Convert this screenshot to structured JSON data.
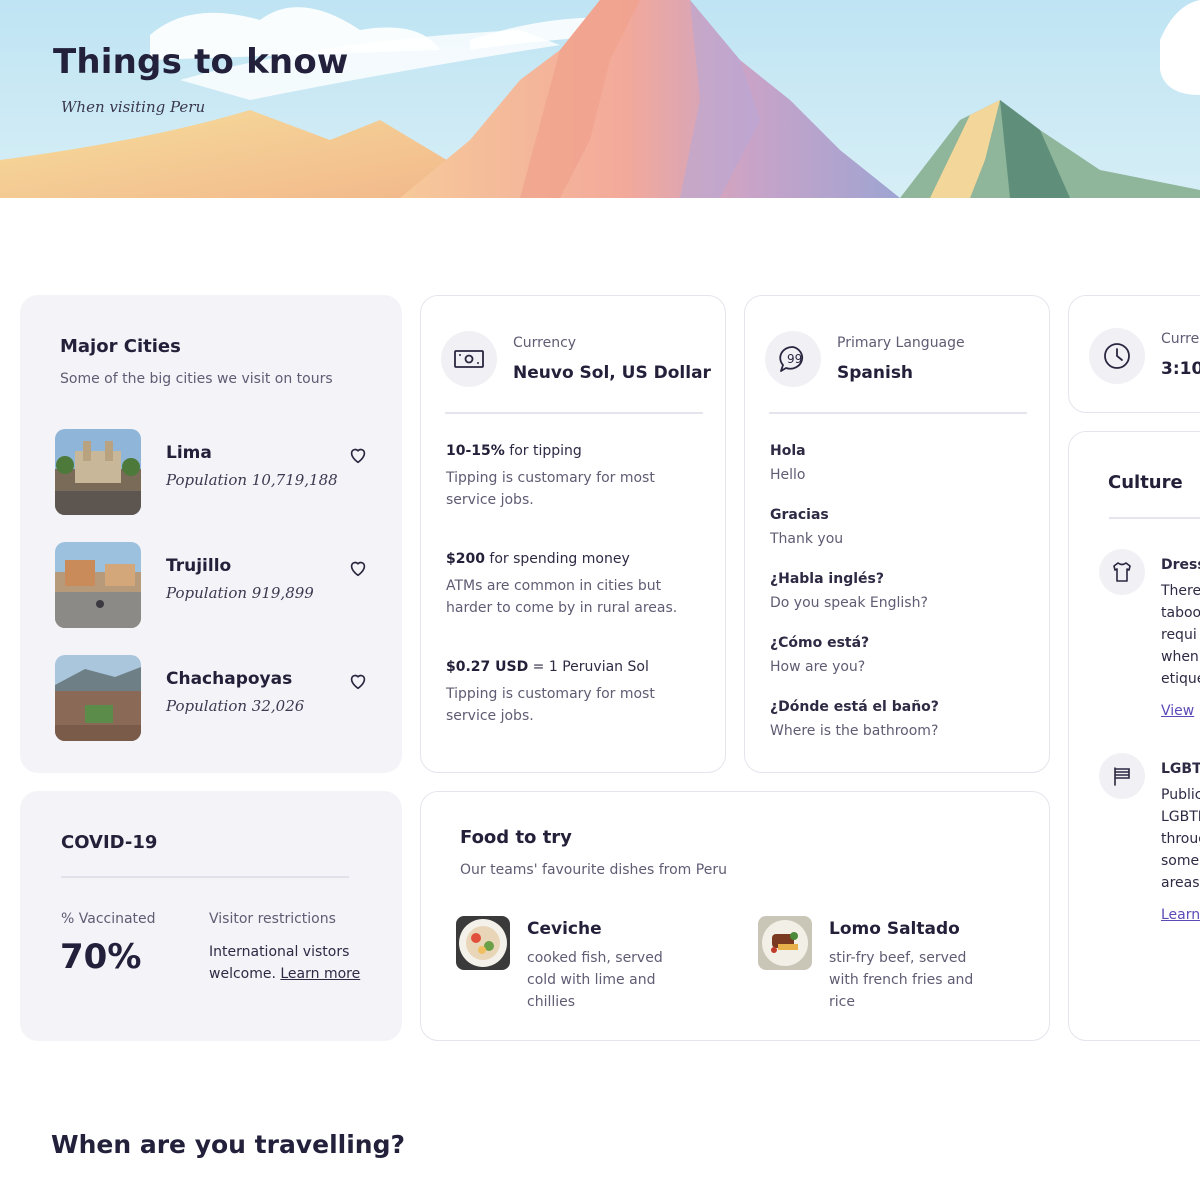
{
  "hero": {
    "title": "Things to know",
    "subtitle": "When visiting Peru"
  },
  "cities": {
    "title": "Major Cities",
    "subtitle": "Some of the big cities we visit on tours",
    "items": [
      {
        "name": "Lima",
        "population": "Population 10,719,188",
        "image_icon": "lima-photo"
      },
      {
        "name": "Trujillo",
        "population": "Population 919,899",
        "image_icon": "trujillo-photo"
      },
      {
        "name": "Chachapoyas",
        "population": "Population 32,026",
        "image_icon": "chachapoyas-photo"
      }
    ]
  },
  "currency": {
    "label": "Currency",
    "value": "Neuvo Sol, US Dollar",
    "icon": "banknote-icon",
    "tips": [
      {
        "bold": "10-15%",
        "rest": " for tipping",
        "desc": "Tipping is customary for most service jobs."
      },
      {
        "bold": "$200",
        "rest": " for spending money",
        "desc": "ATMs are common in cities but harder to come by in rural areas."
      },
      {
        "bold": "$0.27 USD",
        "rest": " = 1 Peruvian Sol",
        "desc": "Tipping is customary for most service jobs."
      }
    ]
  },
  "language": {
    "label": "Primary Language",
    "value": "Spanish",
    "icon": "speech-bubble-icon",
    "phrases": [
      {
        "phrase": "Hola",
        "translation": "Hello"
      },
      {
        "phrase": "Gracias",
        "translation": "Thank you"
      },
      {
        "phrase": "¿Habla inglés?",
        "translation": "Do you speak English?"
      },
      {
        "phrase": "¿Cómo está?",
        "translation": "How are you?"
      },
      {
        "phrase": "¿Dónde está el baño?",
        "translation": "Where is the bathroom?"
      }
    ]
  },
  "time": {
    "label": "Curre",
    "value": "3:10 |",
    "icon": "clock-icon"
  },
  "culture": {
    "title": "Culture",
    "items": [
      {
        "heading": "Dress",
        "icon": "shirt-icon",
        "lines": [
          "There",
          "taboo",
          "requi",
          "when",
          "etique"
        ],
        "link": "View"
      },
      {
        "heading": "LGBT",
        "icon": "flag-icon",
        "lines": [
          "Public",
          "LGBTI",
          "throug",
          "some",
          "areas."
        ],
        "link": "Learn"
      }
    ]
  },
  "covid": {
    "title": "COVID-19",
    "vaccinated_label": "% Vaccinated",
    "vaccinated_value": "70%",
    "restrictions_label": "Visitor restrictions",
    "restrictions_text": "International vistors welcome.",
    "restrictions_link": "Learn more"
  },
  "food": {
    "title": "Food to try",
    "subtitle": "Our teams' favourite dishes from Peru",
    "items": [
      {
        "name": "Ceviche",
        "desc": "cooked fish, served cold with lime and chillies"
      },
      {
        "name": "Lomo Saltado",
        "desc": "stir-fry beef, served with french fries and rice"
      }
    ]
  },
  "travel": {
    "title": "When are you travelling?"
  },
  "colors": {
    "card_soft": "#f4f3f8",
    "card_border": "#e6e4ec",
    "text_dark": "#24203a",
    "text_muted": "#5f5c73",
    "link_accent": "#5b4bb7"
  }
}
